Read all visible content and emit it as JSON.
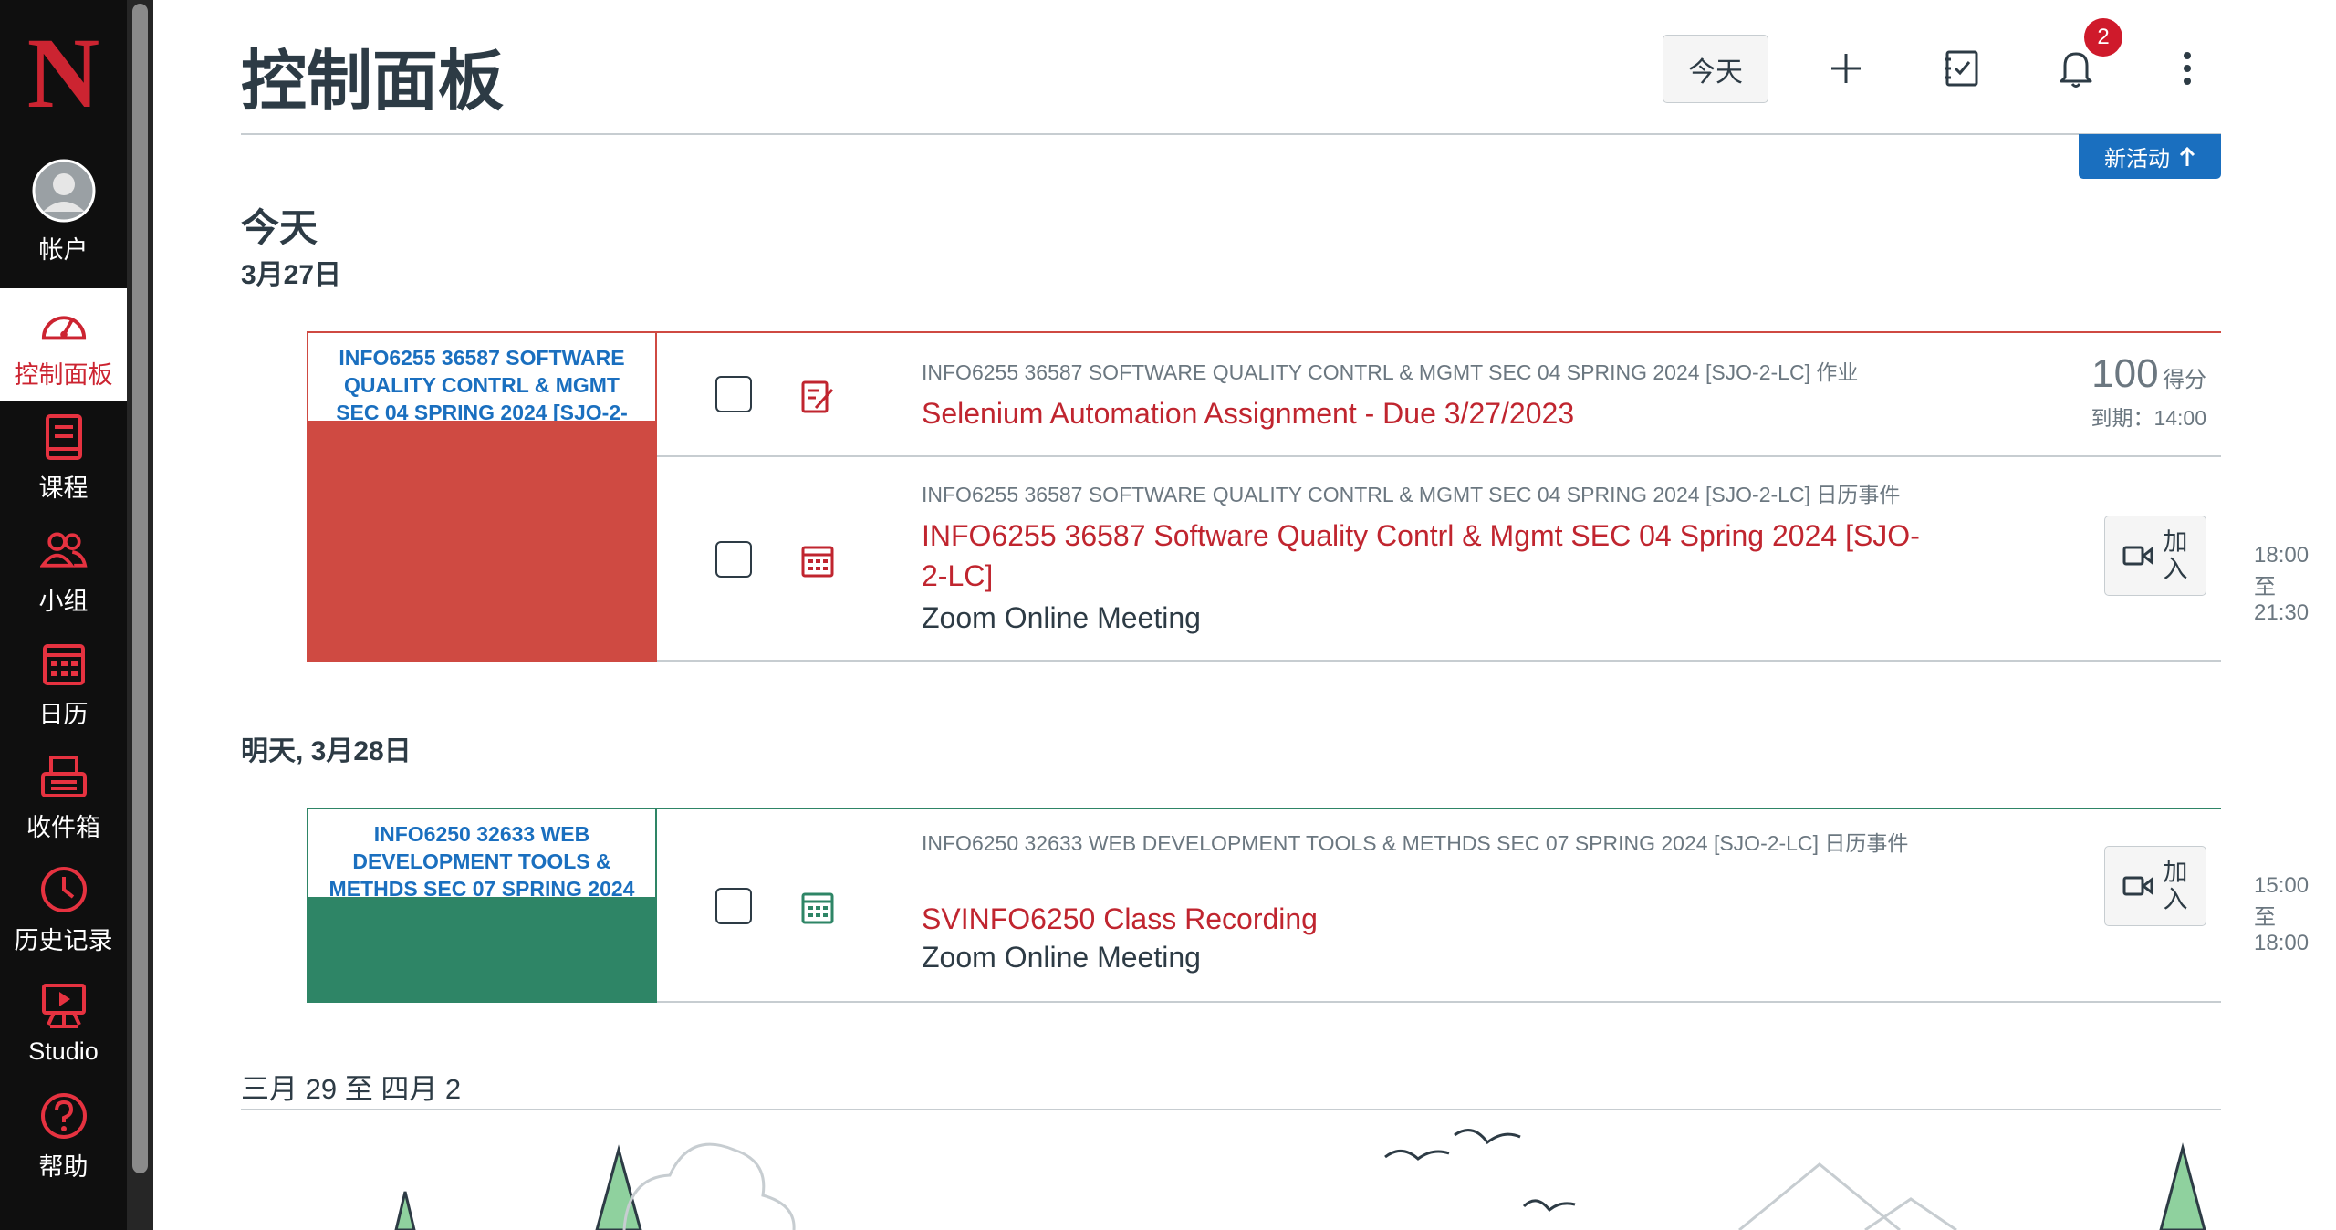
{
  "brand": {
    "logo_letter": "N",
    "accent": "#cc2431"
  },
  "sidebar": {
    "items": [
      {
        "label": "帐户",
        "icon": "account-avatar-icon"
      },
      {
        "label": "控制面板",
        "icon": "dashboard-icon",
        "active": true
      },
      {
        "label": "课程",
        "icon": "courses-icon"
      },
      {
        "label": "小组",
        "icon": "groups-icon"
      },
      {
        "label": "日历",
        "icon": "calendar-icon"
      },
      {
        "label": "收件箱",
        "icon": "inbox-icon"
      },
      {
        "label": "历史记录",
        "icon": "history-icon"
      },
      {
        "label": "Studio",
        "icon": "studio-icon"
      },
      {
        "label": "帮助",
        "icon": "help-icon"
      }
    ]
  },
  "header": {
    "title": "控制面板",
    "today_button": "今天",
    "notifications_count": "2",
    "new_activity": "新活动"
  },
  "days": [
    {
      "title": "今天",
      "date": "3月27日",
      "groups": [
        {
          "course_name": "INFO6255 36587 SOFTWARE QUALITY CONTRL & MGMT SEC 04 SPRING 2024 [SJO-2-LC]",
          "color": "#cf4a42",
          "name_color": "#1a6fbf",
          "items": [
            {
              "meta": "INFO6255 36587 SOFTWARE QUALITY CONTRL & MGMT SEC 04 SPRING 2024 [SJO-2-LC] 作业",
              "title": "Selenium Automation Assignment - Due 3/27/2023",
              "points": "100",
              "points_label": "得分",
              "due": "到期：14:00",
              "type_icon": "assignment-icon"
            },
            {
              "meta": "INFO6255 36587 SOFTWARE QUALITY CONTRL & MGMT SEC 04 SPRING 2024 [SJO-2-LC] 日历事件",
              "title": "INFO6255 36587 Software Quality Contrl & Mgmt SEC 04 Spring 2024 [SJO-2-LC]",
              "location": "Zoom Online Meeting",
              "time": "18:00 至 21:30",
              "join": "加入",
              "type_icon": "calendar-event-icon"
            }
          ]
        }
      ]
    },
    {
      "title": "明天, 3月28日",
      "groups": [
        {
          "course_name": "INFO6250 32633 WEB DEVELOPMENT TOOLS & METHDS SEC 07 SPRING 2024 [SJO-2-LC]",
          "color": "#2e8566",
          "name_color": "#1a6fbf",
          "items": [
            {
              "meta": "INFO6250 32633 WEB DEVELOPMENT TOOLS & METHDS SEC 07 SPRING 2024 [SJO-2-LC] 日历事件",
              "title": "SVINFO6250 Class Recording",
              "location": "Zoom Online Meeting",
              "time": "15:00 至 18:00",
              "join": "加入",
              "type_icon": "calendar-event-icon"
            }
          ]
        }
      ]
    }
  ],
  "upcoming_range": "三月 29 至 四月 2"
}
